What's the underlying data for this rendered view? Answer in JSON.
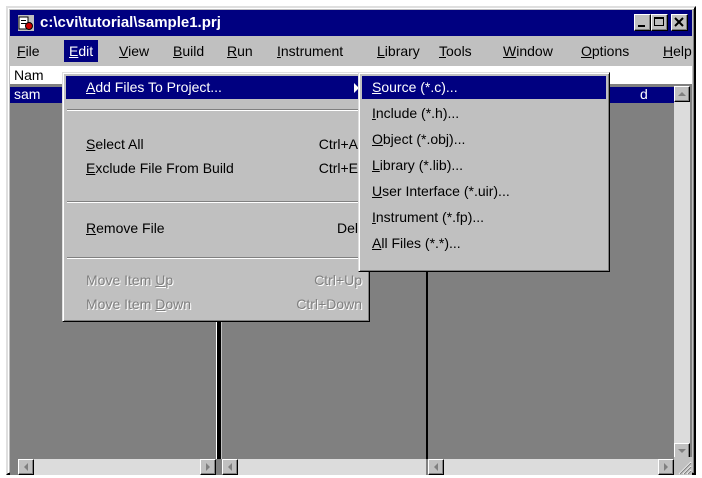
{
  "window": {
    "title": "c:\\cvi\\tutorial\\sample1.prj",
    "buttons": [
      "minimize-button",
      "maximize-button",
      "close-button"
    ]
  },
  "menubar": [
    {
      "label": "File",
      "key": "F",
      "rest": "ile"
    },
    {
      "label": "Edit",
      "key": "E",
      "rest": "dit"
    },
    {
      "label": "View",
      "key": "V",
      "rest": "iew"
    },
    {
      "label": "Build",
      "key": "B",
      "rest": "uild"
    },
    {
      "label": "Run",
      "key": "R",
      "rest": "un"
    },
    {
      "label": "Instrument",
      "key": "I",
      "rest": "nstrument"
    },
    {
      "label": "Library",
      "key": "L",
      "rest": "ibrary"
    },
    {
      "label": "Tools",
      "key": "T",
      "rest": "ools"
    },
    {
      "label": "Window",
      "key": "W",
      "rest": "indow"
    },
    {
      "label": "Options",
      "key": "O",
      "rest": "ptions"
    },
    {
      "label": "Help",
      "key": "H",
      "rest": "elp"
    }
  ],
  "project_list": {
    "header_name": "Nam",
    "selected_row": "sam",
    "selected_row_tail": "d"
  },
  "edit_menu": {
    "add_files": {
      "pre": "",
      "key": "A",
      "post": "dd Files To Project..."
    },
    "select_all": {
      "pre": "",
      "key": "S",
      "post": "elect All",
      "shortcut": "Ctrl+A"
    },
    "exclude_file": {
      "pre": "",
      "key": "E",
      "post": "xclude File From Build",
      "shortcut": "Ctrl+E"
    },
    "remove_file": {
      "pre": "",
      "key": "R",
      "post": "emove File",
      "shortcut": "Del"
    },
    "move_up": {
      "pre": "Move Item ",
      "key": "U",
      "post": "p",
      "shortcut": "Ctrl+Up"
    },
    "move_down": {
      "pre": "Move Item ",
      "key": "D",
      "post": "own",
      "shortcut": "Ctrl+Down"
    }
  },
  "add_files_submenu": [
    {
      "key": "S",
      "rest": "ource (*.c)..."
    },
    {
      "key": "I",
      "rest": "nclude (*.h)..."
    },
    {
      "key": "O",
      "rest": "bject (*.obj)..."
    },
    {
      "key": "L",
      "rest": "ibrary (*.lib)..."
    },
    {
      "key": "U",
      "rest": "ser Interface (*.uir)..."
    },
    {
      "key": "I",
      "rest": "nstrument (*.fp)..."
    },
    {
      "key": "A",
      "rest": "ll Files (*.*)..."
    }
  ],
  "colors": {
    "titlebar": "#000080",
    "highlight": "#000080",
    "face": "#c0c0c0",
    "workspace": "#808080"
  }
}
